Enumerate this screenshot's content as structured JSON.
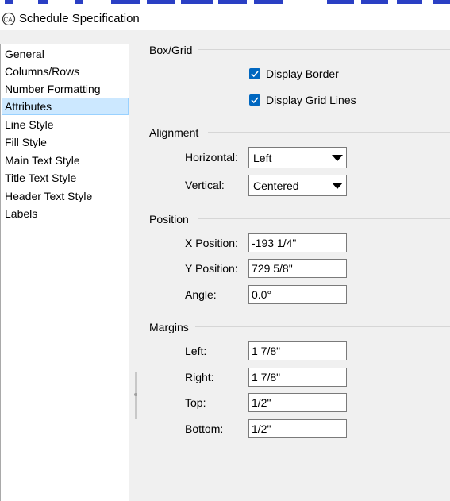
{
  "window": {
    "title": "Schedule Specification"
  },
  "nav": {
    "items": [
      {
        "label": "General"
      },
      {
        "label": "Columns/Rows"
      },
      {
        "label": "Number Formatting"
      },
      {
        "label": "Attributes",
        "selected": true
      },
      {
        "label": "Line Style"
      },
      {
        "label": "Fill Style"
      },
      {
        "label": "Main Text Style"
      },
      {
        "label": "Title Text Style"
      },
      {
        "label": "Header Text Style"
      },
      {
        "label": "Labels"
      }
    ]
  },
  "box_grid": {
    "heading": "Box/Grid",
    "display_border": {
      "label": "Display Border",
      "checked": true
    },
    "display_grid_lines": {
      "label": "Display Grid Lines",
      "checked": true
    }
  },
  "alignment": {
    "heading": "Alignment",
    "horizontal": {
      "label": "Horizontal:",
      "value": "Left"
    },
    "vertical": {
      "label": "Vertical:",
      "value": "Centered"
    }
  },
  "position": {
    "heading": "Position",
    "x": {
      "label": "X Position:",
      "value": "-193 1/4\""
    },
    "y": {
      "label": "Y Position:",
      "value": "729 5/8\""
    },
    "angle": {
      "label": "Angle:",
      "value": "0.0°"
    }
  },
  "margins": {
    "heading": "Margins",
    "left": {
      "label": "Left:",
      "value": "1 7/8\""
    },
    "right": {
      "label": "Right:",
      "value": "1 7/8\""
    },
    "top": {
      "label": "Top:",
      "value": "1/2\""
    },
    "bottom": {
      "label": "Bottom:",
      "value": "1/2\""
    }
  },
  "colors": {
    "accent": "#0067c0",
    "selection": "#cce8ff"
  }
}
